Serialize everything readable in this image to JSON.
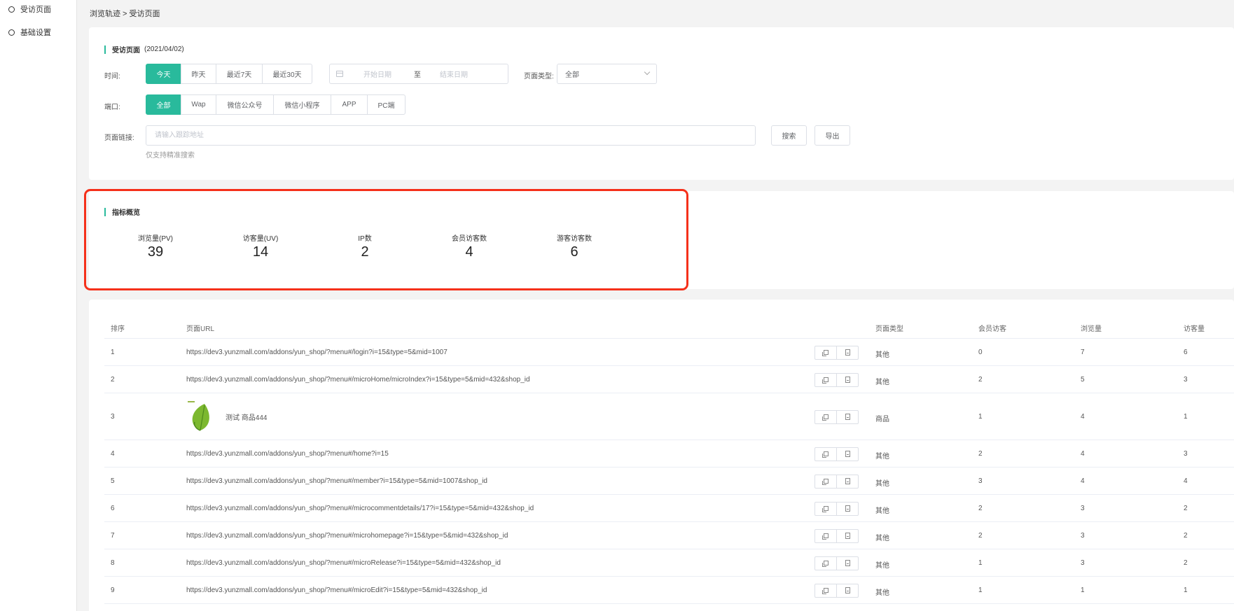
{
  "sidebar": {
    "items": [
      {
        "label": "受访页面"
      },
      {
        "label": "基础设置"
      }
    ]
  },
  "breadcrumb": "浏览轨迹 > 受访页面",
  "filter": {
    "title": "受访页面",
    "date": "(2021/04/02)",
    "time_label": "时间:",
    "time_options": [
      "今天",
      "昨天",
      "最近7天",
      "最近30天"
    ],
    "date_start_placeholder": "开始日期",
    "date_to": "至",
    "date_end_placeholder": "结束日期",
    "page_type_label": "页面类型:",
    "page_type_value": "全部",
    "port_label": "端口:",
    "port_options": [
      "全部",
      "Wap",
      "微信公众号",
      "微信小程序",
      "APP",
      "PC端"
    ],
    "link_label": "页面链接:",
    "link_placeholder": "请输入跟踪地址",
    "search_label": "搜索",
    "export_label": "导出",
    "hint": "仅支持精准搜索"
  },
  "metrics": {
    "title": "指标概览",
    "items": [
      {
        "label": "浏览量(PV)",
        "value": "39"
      },
      {
        "label": "访客量(UV)",
        "value": "14"
      },
      {
        "label": "IP数",
        "value": "2"
      },
      {
        "label": "会员访客数",
        "value": "4"
      },
      {
        "label": "游客访客数",
        "value": "6"
      }
    ]
  },
  "table": {
    "headers": [
      "排序",
      "页面URL",
      "页面类型",
      "会员访客",
      "浏览量",
      "访客量"
    ],
    "rows": [
      {
        "rank": "1",
        "url": "https://dev3.yunzmall.com/addons/yun_shop/?menu#/login?i=15&type=5&mid=1007",
        "type": "其他",
        "member": "0",
        "pv": "7",
        "uv": "6"
      },
      {
        "rank": "2",
        "url": "https://dev3.yunzmall.com/addons/yun_shop/?menu#/microHome/microIndex?i=15&type=5&mid=432&shop_id",
        "type": "其他",
        "member": "2",
        "pv": "5",
        "uv": "3"
      },
      {
        "rank": "3",
        "url": "测试 商品444",
        "type": "商品",
        "member": "1",
        "pv": "4",
        "uv": "1"
      },
      {
        "rank": "4",
        "url": "https://dev3.yunzmall.com/addons/yun_shop/?menu#/home?i=15",
        "type": "其他",
        "member": "2",
        "pv": "4",
        "uv": "3"
      },
      {
        "rank": "5",
        "url": "https://dev3.yunzmall.com/addons/yun_shop/?menu#/member?i=15&type=5&mid=1007&shop_id",
        "type": "其他",
        "member": "3",
        "pv": "4",
        "uv": "4"
      },
      {
        "rank": "6",
        "url": "https://dev3.yunzmall.com/addons/yun_shop/?menu#/microcommentdetails/17?i=15&type=5&mid=432&shop_id",
        "type": "其他",
        "member": "2",
        "pv": "3",
        "uv": "2"
      },
      {
        "rank": "7",
        "url": "https://dev3.yunzmall.com/addons/yun_shop/?menu#/microhomepage?i=15&type=5&mid=432&shop_id",
        "type": "其他",
        "member": "2",
        "pv": "3",
        "uv": "2"
      },
      {
        "rank": "8",
        "url": "https://dev3.yunzmall.com/addons/yun_shop/?menu#/microRelease?i=15&type=5&mid=432&shop_id",
        "type": "其他",
        "member": "1",
        "pv": "3",
        "uv": "2"
      },
      {
        "rank": "9",
        "url": "https://dev3.yunzmall.com/addons/yun_shop/?menu#/microEdit?i=15&type=5&mid=432&shop_id",
        "type": "其他",
        "member": "1",
        "pv": "1",
        "uv": "1"
      }
    ]
  },
  "colors": {
    "accent": "#29ba9c",
    "highlight": "#f5301a"
  }
}
